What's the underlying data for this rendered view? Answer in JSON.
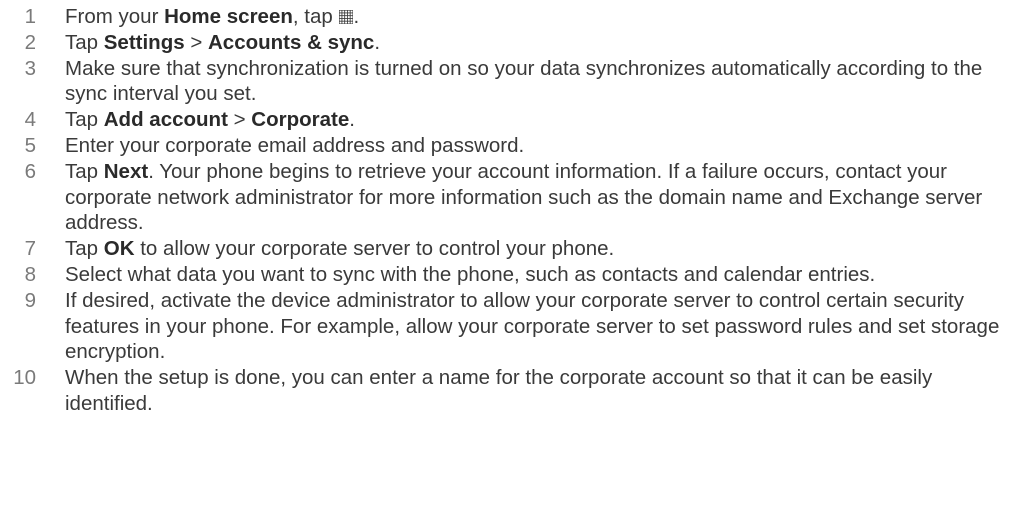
{
  "steps": [
    {
      "num": "1",
      "parts": [
        {
          "t": "From your "
        },
        {
          "t": "Home screen",
          "b": true
        },
        {
          "t": ", tap "
        },
        {
          "icon": "apps-grid-icon"
        },
        {
          "t": "."
        }
      ]
    },
    {
      "num": "2",
      "parts": [
        {
          "t": "Tap "
        },
        {
          "t": "Settings",
          "b": true
        },
        {
          "t": " > "
        },
        {
          "t": "Accounts & sync",
          "b": true
        },
        {
          "t": "."
        }
      ]
    },
    {
      "num": "3",
      "parts": [
        {
          "t": "Make sure that synchronization is turned on so your data synchronizes automatically according to the sync interval you set."
        }
      ]
    },
    {
      "num": "4",
      "parts": [
        {
          "t": "Tap "
        },
        {
          "t": "Add account",
          "b": true
        },
        {
          "t": " > "
        },
        {
          "t": "Corporate",
          "b": true
        },
        {
          "t": "."
        }
      ]
    },
    {
      "num": "5",
      "parts": [
        {
          "t": "Enter your corporate email address and password."
        }
      ]
    },
    {
      "num": "6",
      "parts": [
        {
          "t": "Tap "
        },
        {
          "t": "Next",
          "b": true
        },
        {
          "t": ". Your phone begins to retrieve your account information. If a failure occurs, contact your corporate network administrator for more information such as the domain name and Exchange server address."
        }
      ]
    },
    {
      "num": "7",
      "parts": [
        {
          "t": "Tap "
        },
        {
          "t": "OK",
          "b": true
        },
        {
          "t": " to allow your corporate server to control your phone."
        }
      ]
    },
    {
      "num": "8",
      "parts": [
        {
          "t": "Select what data you want to sync with the phone, such as contacts and calendar entries."
        }
      ]
    },
    {
      "num": "9",
      "parts": [
        {
          "t": "If desired, activate the device administrator to allow your corporate server to control certain security features in your phone. For example, allow your corporate server to set password rules and set storage encryption."
        }
      ]
    },
    {
      "num": "10",
      "parts": [
        {
          "t": "When the setup is done, you can enter a name for the corporate account so that it can be easily identified."
        }
      ]
    }
  ]
}
